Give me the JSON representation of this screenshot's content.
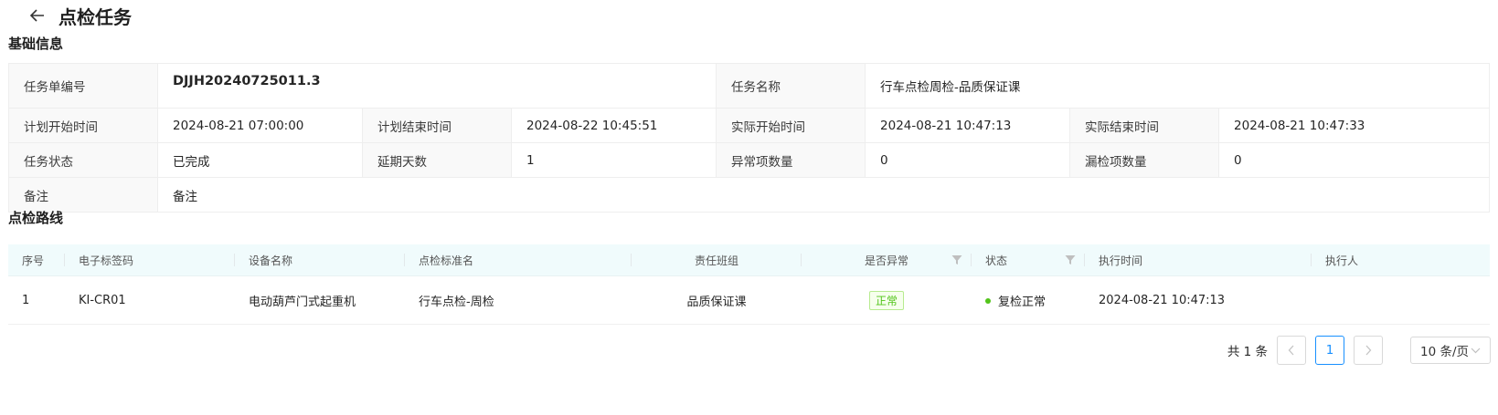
{
  "page": {
    "title": "点检任务",
    "back_icon": "arrow-left-icon"
  },
  "basic_info": {
    "section_title": "基础信息",
    "task_code_label": "任务单编号",
    "task_code": "DJJH20240725011.3",
    "task_name_label": "任务名称",
    "task_name": "行车点检周检-品质保证课",
    "plan_start_label": "计划开始时间",
    "plan_start": "2024-08-21 07:00:00",
    "plan_end_label": "计划结束时间",
    "plan_end": "2024-08-22 10:45:51",
    "actual_start_label": "实际开始时间",
    "actual_start": "2024-08-21 10:47:13",
    "actual_end_label": "实际结束时间",
    "actual_end": "2024-08-21 10:47:33",
    "status_label": "任务状态",
    "status": "已完成",
    "delay_label": "延期天数",
    "delay": "1",
    "abnormal_label": "异常项数量",
    "abnormal": "0",
    "missed_label": "漏检项数量",
    "missed": "0",
    "remark_label": "备注",
    "remark": "备注"
  },
  "route": {
    "section_title": "点检路线",
    "columns": [
      "序号",
      "电子标签码",
      "设备名称",
      "点检标准名",
      "责任班组",
      "是否异常",
      "状态",
      "执行时间",
      "执行人"
    ],
    "rows": [
      {
        "index": "1",
        "tag_code": "KI-CR01",
        "equipment": "电动葫芦门式起重机",
        "standard": "行车点检-周检",
        "team": "品质保证课",
        "abnormal": "正常",
        "status": "复检正常",
        "exec_time": "2024-08-21 10:47:13",
        "executor": ""
      }
    ]
  },
  "pagination": {
    "total_text": "共 1 条",
    "current_page": "1",
    "page_size": "10 条/页",
    "prev_icon": "chevron-left-icon",
    "next_icon": "chevron-right-icon",
    "size_icon": "chevron-down-icon"
  },
  "colors": {
    "accent": "#1890ff",
    "success": "#52c41a",
    "table_header_bg": "#f0fbfc"
  }
}
